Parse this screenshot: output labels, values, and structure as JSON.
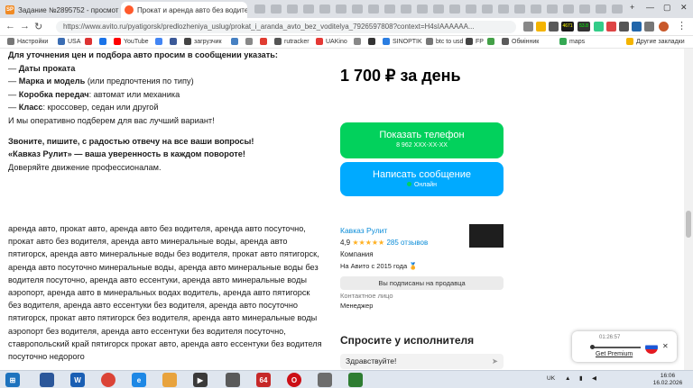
{
  "browser": {
    "tabs": [
      {
        "label": "Задание №2895752 - просмотр з...",
        "favicon": "SP",
        "favicon_color": "#f08a24"
      },
      {
        "label": "Прокат и аренда авто без водите...",
        "favicon": "",
        "favicon_color": "#ff5a2c"
      }
    ],
    "url": "https://www.avito.ru/pyatigorsk/predlozheniya_uslug/prokat_i_aranda_avto_bez_voditelya_7926597808?context=H4sIAAAAAA...",
    "ext_badges": {
      "ltc": "LTC",
      "val1": "4671",
      "val2": "53.8"
    },
    "bookmarks": [
      {
        "label": "Настройки",
        "color": "#777"
      },
      {
        "label": "USA",
        "color": "#3b6db3"
      },
      {
        "label": "",
        "color": "#d33"
      },
      {
        "label": "",
        "color": "#1a73e8"
      },
      {
        "label": "YouTube",
        "color": "#ff0000"
      },
      {
        "label": "",
        "color": "#4285f4"
      },
      {
        "label": "",
        "color": "#3b5998"
      },
      {
        "label": "загрузчик",
        "color": "#444"
      },
      {
        "label": "",
        "color": "#4680c2"
      },
      {
        "label": "",
        "color": "#888"
      },
      {
        "label": "",
        "color": "#e03c31"
      },
      {
        "label": "rutracker",
        "color": "#555"
      },
      {
        "label": "UAKino",
        "color": "#e53935"
      },
      {
        "label": "",
        "color": "#888"
      },
      {
        "label": "",
        "color": "#333"
      },
      {
        "label": "SINOPTIK",
        "color": "#2a7de1"
      },
      {
        "label": "btc to usd",
        "color": "#777"
      },
      {
        "label": "FP",
        "color": "#444"
      },
      {
        "label": "",
        "color": "#43a047"
      },
      {
        "label": "Обмінник",
        "color": "#5b5b5b"
      },
      {
        "label": "maps",
        "color": "#34a853"
      },
      {
        "label": "Другие закладки",
        "color": "#f4b400"
      }
    ]
  },
  "listing": {
    "intro": "Для уточнения цен и подбора авто просим в сообщении указать:",
    "items": [
      {
        "bold": "Даты проката",
        "rest": ""
      },
      {
        "bold": "Марка и модель",
        "rest": " (или предпочтения по типу)"
      },
      {
        "bold": "Коробка передач",
        "rest": ": автомат или механика"
      },
      {
        "bold": "Класс",
        "rest": ": кроссовер, седан или другой"
      }
    ],
    "dash": "— ",
    "best_option": "И мы оперативно подберем для вас лучший вариант!",
    "call_line": "Звоните, пишите, с радостью отвечу на все ваши вопросы!",
    "slogan": "«Кавказ Рулит» — ваша уверенность в каждом повороте!",
    "trust": "Доверяйте движение профессионалам.",
    "keywords": "аренда авто, прокат авто, аренда авто без водителя, аренда авто посуточно, прокат авто без водителя, аренда авто минеральные воды, аренда авто пятигорск, аренда авто минеральные воды без водителя, прокат авто пятигорск, аренда авто посуточно минеральные воды, аренда авто минеральные воды без водителя посуточно, аренда авто ессентуки, аренда авто минеральные воды аэропорт, аренда авто в минеральных водах водитель, аренда авто пятигорск без водителя, аренда авто ессентуки без водителя, аренда авто посуточно пятигорск, прокат авто пятигорск без водителя, аренда авто минеральные воды аэропорт без водителя, аренда авто ессентуки без водителя посуточно, ставропольский край пятигорск прокат авто, аренда авто ессентуки без водителя посуточно недорого"
  },
  "sidebar": {
    "price": "1 700 ₽ за день",
    "show_phone": "Показать телефон",
    "phone": "8 962 XXX-XX-XX",
    "write_message": "Написать сообщение",
    "online": "Онлайн",
    "seller_name": "Кавказ Рулит",
    "rating": "4,9",
    "stars": "★★★★★",
    "reviews": "285 отзывов",
    "seller_type": "Компания",
    "since": "На Авито с 2015 года",
    "subscribed": "Вы подписаны на продавца",
    "contact_label": "Контактное лицо",
    "contact_value": "Менеджер",
    "ask_title": "Спросите у исполнителя",
    "ask_value": "Здравствуйте!"
  },
  "translator_popup": {
    "time": "01:26:57",
    "premium": "Get Premium"
  },
  "taskbar": {
    "lang": "UK",
    "time": "16:06",
    "date": "16.02.2026",
    "apps": [
      {
        "name": "windows-start",
        "color": "#1e73be",
        "label": "⊞"
      },
      {
        "name": "explorer",
        "color": "#2b579a",
        "label": ""
      },
      {
        "name": "wapp",
        "color": "#1a5fb4",
        "label": "W"
      },
      {
        "name": "chrome",
        "color": "#db4437",
        "label": ""
      },
      {
        "name": "ie",
        "color": "#1e88e5",
        "label": "e"
      },
      {
        "name": "folder",
        "color": "#e8a33d",
        "label": ""
      },
      {
        "name": "media",
        "color": "#3a3a3a",
        "label": "▶"
      },
      {
        "name": "calc",
        "color": "#5a5a5a",
        "label": ""
      },
      {
        "name": "sixtyfour",
        "color": "#c62828",
        "label": "64"
      },
      {
        "name": "opera",
        "color": "#cc0f16",
        "label": "O"
      },
      {
        "name": "doc",
        "color": "#6d6d6d",
        "label": ""
      },
      {
        "name": "green",
        "color": "#2e7d32",
        "label": ""
      }
    ]
  }
}
